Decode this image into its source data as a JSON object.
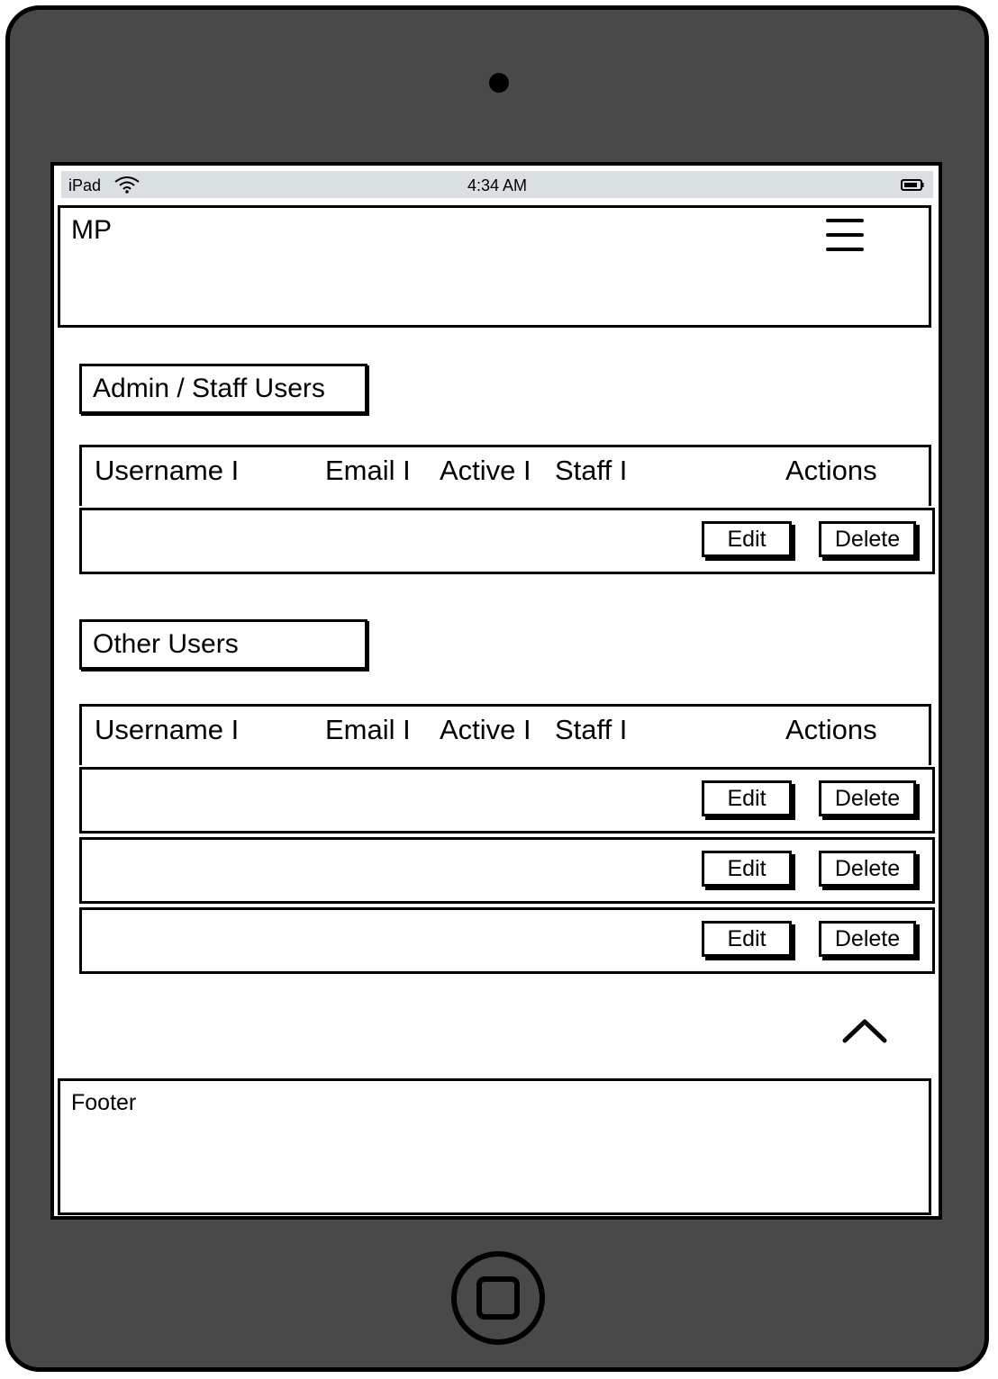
{
  "status_bar": {
    "device": "iPad",
    "time": "4:34 AM",
    "wifi_icon": "wifi-icon",
    "battery_icon": "battery-icon"
  },
  "navbar": {
    "brand": "MP",
    "menu_icon": "hamburger-icon"
  },
  "admin_section": {
    "title": "Admin / Staff Users",
    "columns": [
      "Username I",
      "Email I",
      "Active I",
      "Staff I",
      "Actions"
    ],
    "rows": [
      {
        "edit_label": "Edit",
        "delete_label": "Delete"
      }
    ]
  },
  "other_section": {
    "title": "Other Users",
    "columns": [
      "Username I",
      "Email I",
      "Active I",
      "Staff I",
      "Actions"
    ],
    "rows": [
      {
        "edit_label": "Edit",
        "delete_label": "Delete"
      },
      {
        "edit_label": "Edit",
        "delete_label": "Delete"
      },
      {
        "edit_label": "Edit",
        "delete_label": "Delete"
      }
    ]
  },
  "back_to_top_icon": "chevron-up-icon",
  "footer": {
    "label": "Footer"
  }
}
